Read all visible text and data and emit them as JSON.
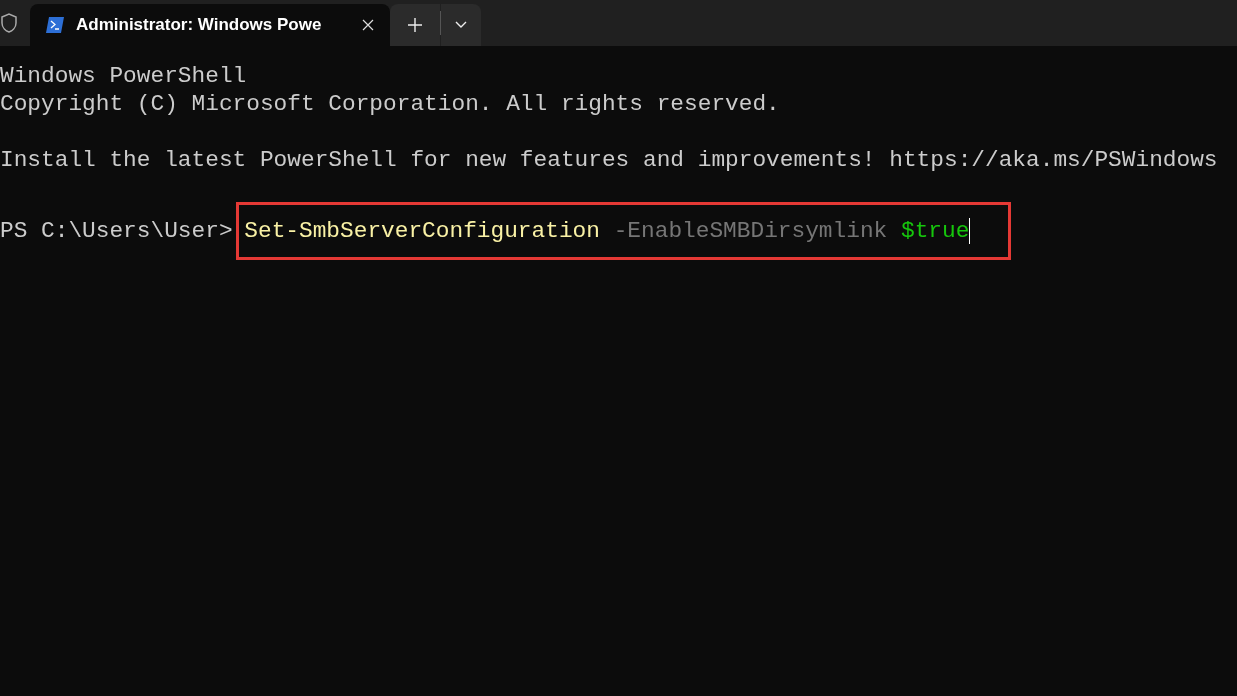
{
  "tabs": [
    {
      "title": "Administrator: Windows Powe",
      "selected": true
    }
  ],
  "output_blocks": [
    [
      "Windows PowerShell",
      "Copyright (C) Microsoft Corporation. All rights reserved."
    ],
    [
      "Install the latest PowerShell for new features and improvements! https://aka.ms/PSWindows"
    ]
  ],
  "prompt": {
    "path": "PS C:\\Users\\User>",
    "command": "Set-SmbServerConfiguration",
    "parameter": "-EnableSMBDirsymlink",
    "value": "$true"
  }
}
